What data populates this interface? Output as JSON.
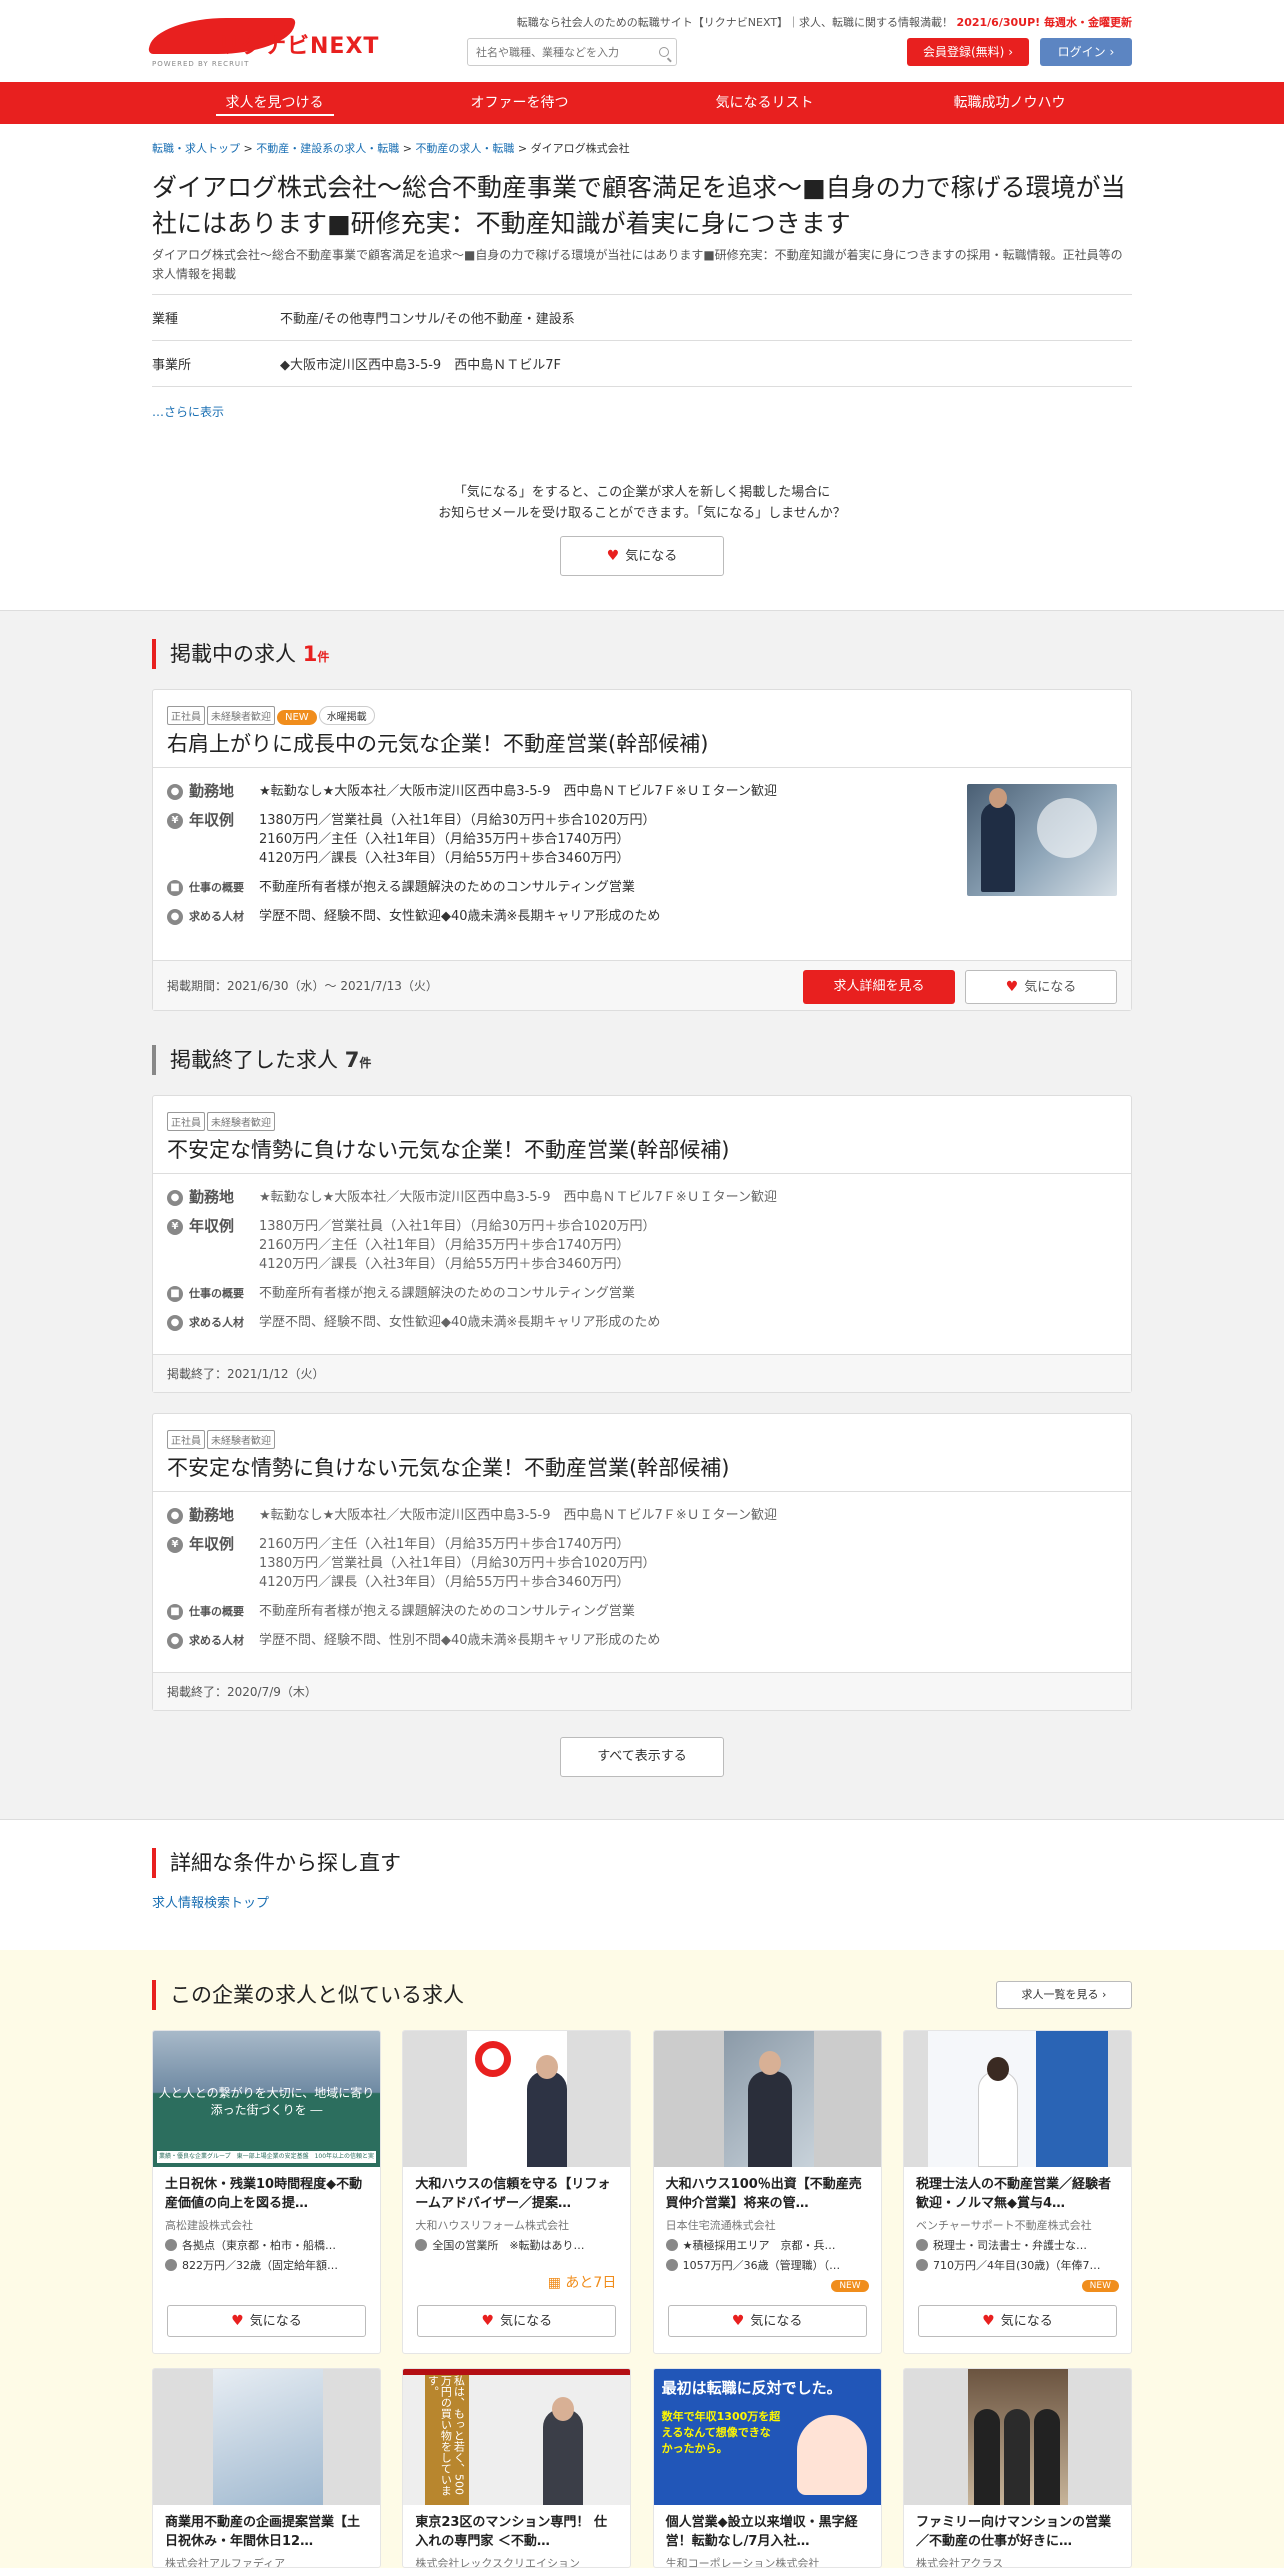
{
  "header": {
    "logo_text": "リクナビNEXT",
    "logo_sub": "POWERED BY RECRUIT",
    "tagline": "転職なら社会人のための転職サイト【リクナビNEXT】｜求人、転職に関する情報満載！",
    "tagline_hl": "2021/6/30UP! 毎週水・金曜更新",
    "search_placeholder": "社名や職種、業種などを入力",
    "register": "会員登録(無料)",
    "login": "ログイン"
  },
  "nav": [
    "求人を見つける",
    "オファーを待つ",
    "気になるリスト",
    "転職成功ノウハウ"
  ],
  "breadcrumb": [
    "転職・求人トップ",
    "不動産・建設系の求人・転職",
    "不動産の求人・転職",
    "ダイアログ株式会社"
  ],
  "company": {
    "title": "ダイアログ株式会社～総合不動産事業で顧客満足を追求～■自身の力で稼げる環境が当社にはあります■研修充実：不動産知識が着実に身につきます",
    "desc": "ダイアログ株式会社～総合不動産事業で顧客満足を追求～■自身の力で稼げる環境が当社にはあります■研修充実：不動産知識が着実に身につきますの採用・転職情報。正社員等の求人情報を掲載",
    "industry_label": "業種",
    "industry": "不動産/その他専門コンサル/その他不動産・建設系",
    "office_label": "事業所",
    "office": "◆大阪市淀川区西中島3-5-9　西中島ＮＴビル7F",
    "more": "…さらに表示"
  },
  "fav_prompt": {
    "line1": "「気になる」をすると、この企業が求人を新しく掲載した場合に",
    "line2": "お知らせメールを受け取ることができます。「気になる」しませんか？",
    "button": "気になる"
  },
  "active_section": {
    "title": "掲載中の求人",
    "count": "1",
    "unit": "件"
  },
  "active_job": {
    "tags": [
      "正社員",
      "未経験者歓迎"
    ],
    "new": "NEW",
    "wed": "水曜掲載",
    "title": "右肩上がりに成長中の元気な企業！不動産営業(幹部候補)",
    "loc_label": "勤務地",
    "loc": "★転勤なし★大阪本社／大阪市淀川区西中島3-5-9　西中島ＮＴビル7Ｆ※ＵＩターン歓迎",
    "salary_label": "年収例",
    "salary": [
      "1380万円／営業社員（入社1年目）（月給30万円＋歩合1020万円）",
      "2160万円／主任（入社1年目）（月給35万円＋歩合1740万円）",
      "4120万円／課長（入社3年目）（月給55万円＋歩合3460万円）"
    ],
    "work_label": "仕事の概要",
    "work": "不動産所有者様が抱える課題解決のためのコンサルティング営業",
    "req_label": "求める人材",
    "req": "学歴不問、経験不問、女性歓迎◆40歳未満※長期キャリア形成のため",
    "period": "掲載期間：2021/6/30（水）～ 2021/7/13（火）",
    "detail_btn": "求人詳細を見る",
    "fav_btn": "気になる"
  },
  "ended_section": {
    "title": "掲載終了した求人",
    "count": "7",
    "unit": "件"
  },
  "ended_jobs": [
    {
      "tags": [
        "正社員",
        "未経験者歓迎"
      ],
      "title": "不安定な情勢に負けない元気な企業！不動産営業(幹部候補)",
      "loc": "★転勤なし★大阪本社／大阪市淀川区西中島3-5-9　西中島ＮＴビル7Ｆ※ＵＩターン歓迎",
      "salary": [
        "1380万円／営業社員（入社1年目）（月給30万円＋歩合1020万円）",
        "2160万円／主任（入社1年目）（月給35万円＋歩合1740万円）",
        "4120万円／課長（入社3年目）（月給55万円＋歩合3460万円）"
      ],
      "work": "不動産所有者様が抱える課題解決のためのコンサルティング営業",
      "req": "学歴不問、経験不問、女性歓迎◆40歳未満※長期キャリア形成のため",
      "end": "掲載終了：2021/1/12（火）"
    },
    {
      "tags": [
        "正社員",
        "未経験者歓迎"
      ],
      "title": "不安定な情勢に負けない元気な企業！不動産営業(幹部候補)",
      "loc": "★転勤なし★大阪本社／大阪市淀川区西中島3-5-9　西中島ＮＴビル7Ｆ※ＵＩターン歓迎",
      "salary": [
        "2160万円／主任（入社1年目）（月給35万円＋歩合1740万円）",
        "1380万円／営業社員（入社1年目）（月給30万円＋歩合1020万円）",
        "4120万円／課長（入社3年目）（月給55万円＋歩合3460万円）"
      ],
      "work": "不動産所有者様が抱える課題解決のためのコンサルティング営業",
      "req": "学歴不問、経験不問、性別不問◆40歳未満※長期キャリア形成のため",
      "end": "掲載終了：2020/7/9（木）"
    }
  ],
  "show_all": "すべて表示する",
  "search_again": {
    "title": "詳細な条件から探し直す",
    "link": "求人情報検索トップ"
  },
  "similar": {
    "title": "この企業の求人と似ている求人",
    "list_btn": "求人一覧を見る",
    "fav": "気になる",
    "cards": [
      {
        "title": "土日祝休・残業10時間程度◆不動産価値の向上を図る提…",
        "company": "高松建設株式会社",
        "loc": "各拠点（東京都・柏市・船橋…",
        "salary": "822万円／32歳（固定給年額…",
        "img_text": "人と人との繋がりを大切に、地域に寄り添った街づくりを ―",
        "img_sub": "業績・優良な企業グループ　東一部上場企業の安定基盤　100年以上の信頼と実績"
      },
      {
        "title": "大和ハウスの信頼を守る【リフォームアドバイザー／提案…",
        "company": "大和ハウスリフォーム株式会社",
        "loc": "全国の営業所　※転勤はあり…",
        "deadline": "あと7日"
      },
      {
        "title": "大和ハウス100％出資【不動産売買仲介営業】将来の管…",
        "company": "日本住宅流通株式会社",
        "loc": "★積極採用エリア　京都・兵…",
        "salary": "1057万円／36歳（管理職）（…",
        "new": "NEW"
      },
      {
        "title": "税理士法人の不動産営業／経験者歓迎・ノルマ無◆賞与4…",
        "company": "ベンチャーサポート不動産株式会社",
        "loc": "税理士・司法書士・弁護士な…",
        "salary": "710万円／4年目(30歳)（年俸7…",
        "new": "NEW"
      },
      {
        "title": "商業用不動産の企画提案営業【土日祝休み・年間休日12…",
        "company": "株式会社アルファディア"
      },
      {
        "title": "東京23区のマンション専門！ 仕入れの専門家 ＜不動…",
        "company": "株式会社レックスクリエイション",
        "img_text": "私は、もっと若く、500万円の買い物をしています。"
      },
      {
        "title": "個人営業◆設立以来増収・黒字経営！転勤なし/7月入社…",
        "company": "生和コーポレーション株式会社",
        "img_text": "最初は転職に反対でした。",
        "img_sub": "数年で年収1300万を超えるなんて想像できなかったから。"
      },
      {
        "title": "ファミリー向けマンションの営業／不動産の仕事が好きに…",
        "company": "株式会社アクラス"
      }
    ]
  },
  "colors": {
    "brand": "#e8201f",
    "login": "#5c85c2",
    "new": "#f08d1c"
  }
}
